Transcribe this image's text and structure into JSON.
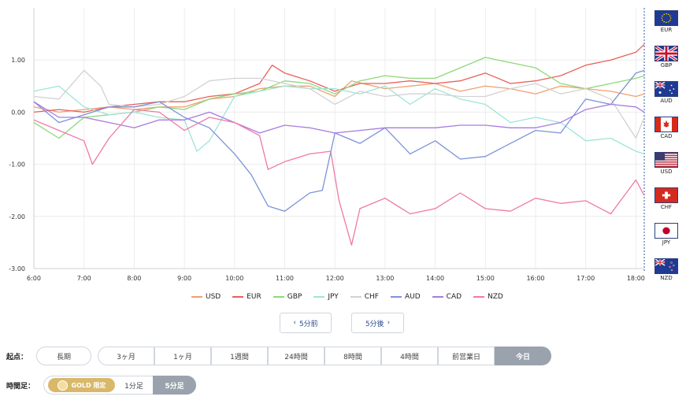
{
  "chart_data": {
    "type": "line",
    "xlabel": "",
    "ylabel": "",
    "ylim": [
      -3.0,
      2.0
    ],
    "x_range": [
      "6:00",
      "18:10"
    ],
    "y_ticks": [
      "1.00",
      "0.00",
      "-1.00",
      "-2.00",
      "-3.00"
    ],
    "y_tick_values": [
      1.0,
      0.0,
      -1.0,
      -2.0,
      -3.0
    ],
    "x_ticks": [
      "6:00",
      "7:00",
      "8:00",
      "9:00",
      "10:00",
      "11:00",
      "12:00",
      "13:00",
      "14:00",
      "15:00",
      "16:00",
      "17:00",
      "18:00"
    ],
    "grid": true,
    "legend_position": "bottom",
    "series": [
      {
        "name": "USD",
        "color": "#f0a070",
        "points": [
          [
            "6:00",
            0.1
          ],
          [
            "6:30",
            0.0
          ],
          [
            "7:00",
            0.05
          ],
          [
            "7:30",
            0.1
          ],
          [
            "8:00",
            0.05
          ],
          [
            "8:30",
            0.1
          ],
          [
            "9:00",
            0.1
          ],
          [
            "9:30",
            0.25
          ],
          [
            "10:00",
            0.3
          ],
          [
            "10:30",
            0.45
          ],
          [
            "11:00",
            0.5
          ],
          [
            "11:30",
            0.5
          ],
          [
            "12:00",
            0.3
          ],
          [
            "12:20",
            0.6
          ],
          [
            "13:00",
            0.45
          ],
          [
            "13:30",
            0.5
          ],
          [
            "14:00",
            0.55
          ],
          [
            "14:30",
            0.4
          ],
          [
            "15:00",
            0.5
          ],
          [
            "15:30",
            0.45
          ],
          [
            "16:00",
            0.35
          ],
          [
            "16:30",
            0.5
          ],
          [
            "17:00",
            0.45
          ],
          [
            "17:30",
            0.4
          ],
          [
            "18:00",
            0.3
          ],
          [
            "18:10",
            0.35
          ]
        ]
      },
      {
        "name": "EUR",
        "color": "#e8605a",
        "points": [
          [
            "6:00",
            0.0
          ],
          [
            "6:30",
            0.05
          ],
          [
            "7:00",
            0.0
          ],
          [
            "7:30",
            0.1
          ],
          [
            "8:00",
            0.15
          ],
          [
            "8:30",
            0.2
          ],
          [
            "9:00",
            0.2
          ],
          [
            "9:30",
            0.3
          ],
          [
            "10:00",
            0.35
          ],
          [
            "10:30",
            0.55
          ],
          [
            "10:45",
            0.9
          ],
          [
            "11:00",
            0.75
          ],
          [
            "11:30",
            0.6
          ],
          [
            "12:00",
            0.4
          ],
          [
            "12:30",
            0.55
          ],
          [
            "13:00",
            0.55
          ],
          [
            "13:30",
            0.6
          ],
          [
            "14:00",
            0.55
          ],
          [
            "14:30",
            0.6
          ],
          [
            "15:00",
            0.75
          ],
          [
            "15:30",
            0.55
          ],
          [
            "16:00",
            0.6
          ],
          [
            "16:30",
            0.7
          ],
          [
            "17:00",
            0.9
          ],
          [
            "17:30",
            1.0
          ],
          [
            "18:00",
            1.15
          ],
          [
            "18:10",
            1.3
          ]
        ]
      },
      {
        "name": "GBP",
        "color": "#8ed87a",
        "points": [
          [
            "6:00",
            -0.2
          ],
          [
            "6:30",
            -0.5
          ],
          [
            "7:00",
            -0.1
          ],
          [
            "7:30",
            -0.05
          ],
          [
            "8:00",
            0.0
          ],
          [
            "8:30",
            0.1
          ],
          [
            "9:00",
            0.05
          ],
          [
            "9:30",
            0.25
          ],
          [
            "10:00",
            0.35
          ],
          [
            "10:30",
            0.4
          ],
          [
            "11:00",
            0.6
          ],
          [
            "11:30",
            0.55
          ],
          [
            "12:00",
            0.35
          ],
          [
            "12:30",
            0.6
          ],
          [
            "13:00",
            0.7
          ],
          [
            "13:30",
            0.65
          ],
          [
            "14:00",
            0.65
          ],
          [
            "14:30",
            0.85
          ],
          [
            "15:00",
            1.05
          ],
          [
            "15:30",
            0.95
          ],
          [
            "16:00",
            0.85
          ],
          [
            "16:30",
            0.55
          ],
          [
            "17:00",
            0.45
          ],
          [
            "17:30",
            0.55
          ],
          [
            "18:00",
            0.65
          ],
          [
            "18:10",
            0.7
          ]
        ]
      },
      {
        "name": "JPY",
        "color": "#9ee5d8",
        "points": [
          [
            "6:00",
            0.4
          ],
          [
            "6:30",
            0.5
          ],
          [
            "7:00",
            0.1
          ],
          [
            "7:30",
            -0.05
          ],
          [
            "8:00",
            0.0
          ],
          [
            "8:30",
            -0.1
          ],
          [
            "9:00",
            -0.15
          ],
          [
            "9:15",
            -0.75
          ],
          [
            "9:30",
            -0.55
          ],
          [
            "10:00",
            0.3
          ],
          [
            "10:30",
            0.4
          ],
          [
            "11:00",
            0.5
          ],
          [
            "11:30",
            0.45
          ],
          [
            "12:00",
            0.45
          ],
          [
            "12:30",
            0.35
          ],
          [
            "13:00",
            0.5
          ],
          [
            "13:30",
            0.15
          ],
          [
            "14:00",
            0.45
          ],
          [
            "14:30",
            0.25
          ],
          [
            "15:00",
            0.15
          ],
          [
            "15:30",
            -0.2
          ],
          [
            "16:00",
            -0.1
          ],
          [
            "16:30",
            -0.2
          ],
          [
            "17:00",
            -0.55
          ],
          [
            "17:30",
            -0.5
          ],
          [
            "18:00",
            -0.75
          ],
          [
            "18:10",
            -0.8
          ]
        ]
      },
      {
        "name": "CHF",
        "color": "#d2d2d2",
        "points": [
          [
            "6:00",
            0.3
          ],
          [
            "6:30",
            0.25
          ],
          [
            "7:00",
            0.8
          ],
          [
            "7:20",
            0.5
          ],
          [
            "7:30",
            0.15
          ],
          [
            "8:00",
            0.1
          ],
          [
            "8:30",
            0.15
          ],
          [
            "9:00",
            0.3
          ],
          [
            "9:30",
            0.6
          ],
          [
            "10:00",
            0.65
          ],
          [
            "10:30",
            0.65
          ],
          [
            "11:00",
            0.55
          ],
          [
            "11:30",
            0.45
          ],
          [
            "12:00",
            0.15
          ],
          [
            "12:30",
            0.4
          ],
          [
            "13:00",
            0.3
          ],
          [
            "13:30",
            0.35
          ],
          [
            "14:00",
            0.35
          ],
          [
            "14:30",
            0.3
          ],
          [
            "15:00",
            0.3
          ],
          [
            "15:30",
            0.45
          ],
          [
            "16:00",
            0.55
          ],
          [
            "16:30",
            0.35
          ],
          [
            "17:00",
            0.45
          ],
          [
            "17:30",
            0.25
          ],
          [
            "18:00",
            -0.5
          ],
          [
            "18:10",
            -0.1
          ]
        ]
      },
      {
        "name": "AUD",
        "color": "#7b93d8",
        "points": [
          [
            "6:00",
            0.2
          ],
          [
            "6:30",
            -0.2
          ],
          [
            "7:00",
            -0.05
          ],
          [
            "7:30",
            0.1
          ],
          [
            "8:00",
            0.1
          ],
          [
            "8:30",
            0.2
          ],
          [
            "9:00",
            -0.1
          ],
          [
            "9:30",
            -0.3
          ],
          [
            "10:00",
            -0.8
          ],
          [
            "10:20",
            -1.2
          ],
          [
            "10:40",
            -1.8
          ],
          [
            "11:00",
            -1.9
          ],
          [
            "11:30",
            -1.55
          ],
          [
            "11:45",
            -1.5
          ],
          [
            "12:00",
            -0.4
          ],
          [
            "12:30",
            -0.6
          ],
          [
            "13:00",
            -0.3
          ],
          [
            "13:30",
            -0.8
          ],
          [
            "14:00",
            -0.55
          ],
          [
            "14:30",
            -0.9
          ],
          [
            "15:00",
            -0.85
          ],
          [
            "15:30",
            -0.6
          ],
          [
            "16:00",
            -0.35
          ],
          [
            "16:30",
            -0.4
          ],
          [
            "17:00",
            0.25
          ],
          [
            "17:30",
            0.15
          ],
          [
            "18:00",
            0.75
          ],
          [
            "18:10",
            0.8
          ]
        ]
      },
      {
        "name": "CAD",
        "color": "#a77be0",
        "points": [
          [
            "6:00",
            0.2
          ],
          [
            "6:30",
            -0.1
          ],
          [
            "7:00",
            -0.1
          ],
          [
            "7:30",
            -0.2
          ],
          [
            "8:00",
            -0.3
          ],
          [
            "8:30",
            -0.15
          ],
          [
            "9:00",
            -0.15
          ],
          [
            "9:30",
            0.0
          ],
          [
            "10:00",
            -0.2
          ],
          [
            "10:30",
            -0.4
          ],
          [
            "11:00",
            -0.25
          ],
          [
            "11:30",
            -0.3
          ],
          [
            "12:00",
            -0.4
          ],
          [
            "12:30",
            -0.35
          ],
          [
            "13:00",
            -0.3
          ],
          [
            "13:30",
            -0.3
          ],
          [
            "14:00",
            -0.3
          ],
          [
            "14:30",
            -0.25
          ],
          [
            "15:00",
            -0.25
          ],
          [
            "15:30",
            -0.3
          ],
          [
            "16:00",
            -0.3
          ],
          [
            "16:30",
            -0.2
          ],
          [
            "17:00",
            0.05
          ],
          [
            "17:30",
            0.15
          ],
          [
            "18:00",
            0.1
          ],
          [
            "18:10",
            0.0
          ]
        ]
      },
      {
        "name": "NZD",
        "color": "#f078a8",
        "points": [
          [
            "6:00",
            -0.15
          ],
          [
            "6:30",
            -0.35
          ],
          [
            "7:00",
            -0.55
          ],
          [
            "7:10",
            -1.0
          ],
          [
            "7:30",
            -0.5
          ],
          [
            "8:00",
            0.05
          ],
          [
            "8:30",
            0.0
          ],
          [
            "9:00",
            -0.35
          ],
          [
            "9:30",
            -0.1
          ],
          [
            "10:00",
            -0.2
          ],
          [
            "10:30",
            -0.45
          ],
          [
            "10:40",
            -1.1
          ],
          [
            "11:00",
            -0.95
          ],
          [
            "11:30",
            -0.8
          ],
          [
            "11:55",
            -0.75
          ],
          [
            "12:05",
            -1.7
          ],
          [
            "12:20",
            -2.55
          ],
          [
            "12:30",
            -1.85
          ],
          [
            "13:00",
            -1.65
          ],
          [
            "13:30",
            -1.95
          ],
          [
            "14:00",
            -1.85
          ],
          [
            "14:30",
            -1.55
          ],
          [
            "15:00",
            -1.85
          ],
          [
            "15:30",
            -1.9
          ],
          [
            "16:00",
            -1.65
          ],
          [
            "16:30",
            -1.75
          ],
          [
            "17:00",
            -1.7
          ],
          [
            "17:30",
            -1.95
          ],
          [
            "18:00",
            -1.3
          ],
          [
            "18:10",
            -1.6
          ]
        ]
      }
    ]
  },
  "flags": [
    {
      "code": "EUR",
      "icon": "eu-flag-icon"
    },
    {
      "code": "GBP",
      "icon": "uk-flag-icon"
    },
    {
      "code": "AUD",
      "icon": "au-flag-icon"
    },
    {
      "code": "CAD",
      "icon": "ca-flag-icon"
    },
    {
      "code": "USD",
      "icon": "us-flag-icon"
    },
    {
      "code": "CHF",
      "icon": "ch-flag-icon"
    },
    {
      "code": "JPY",
      "icon": "jp-flag-icon"
    },
    {
      "code": "NZD",
      "icon": "nz-flag-icon"
    }
  ],
  "nav": {
    "prev_label": "5分前",
    "next_label": "5分後"
  },
  "start_point": {
    "label": "起点：",
    "long_label": "長期",
    "options": [
      "3ヶ月",
      "1ヶ月",
      "1週間",
      "24時間",
      "8時間",
      "4時間",
      "前営業日",
      "今日"
    ],
    "selected": "今日"
  },
  "timeframe": {
    "label": "時間足：",
    "gold_label": "GOLD 限定",
    "options": [
      "1分足",
      "5分足"
    ],
    "selected": "5分足"
  }
}
